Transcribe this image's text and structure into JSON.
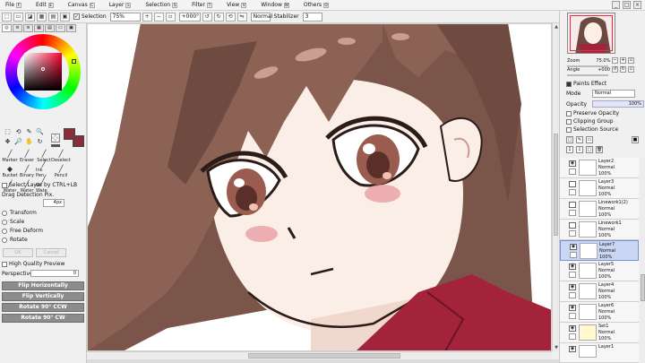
{
  "menubar": {
    "items": [
      {
        "label": "File",
        "key": "F"
      },
      {
        "label": "Edit",
        "key": "E"
      },
      {
        "label": "Canvas",
        "key": "C"
      },
      {
        "label": "Layer",
        "key": "L"
      },
      {
        "label": "Selection",
        "key": "S"
      },
      {
        "label": "Filter",
        "key": "T"
      },
      {
        "label": "View",
        "key": "V"
      },
      {
        "label": "Window",
        "key": "W"
      },
      {
        "label": "Others",
        "key": "O"
      }
    ],
    "window_controls": [
      "_",
      "□",
      "×"
    ]
  },
  "toolbar": {
    "selection_label": "Selection",
    "selection_checked": true,
    "zoom": "75%",
    "rotation": "+000°",
    "blend_mode": "Normal",
    "stabilizer_label": "Stabilizer",
    "stabilizer_value": "3"
  },
  "left_panel": {
    "primary_color": "#8a2d3b",
    "small_tools": [
      "⬚",
      "⟲",
      "✎",
      "🔍",
      "✥",
      "🔎",
      "✋",
      "↻"
    ],
    "brush_tools": [
      {
        "label": "Marker",
        "icon": "marker-icon"
      },
      {
        "label": "Eraser",
        "icon": "eraser-icon"
      },
      {
        "label": "Select",
        "icon": "select-brush-icon"
      },
      {
        "label": "Deselect",
        "icon": "deselect-icon"
      },
      {
        "label": "",
        "icon": "empty"
      },
      {
        "label": "Bucket",
        "icon": "bucket-icon"
      },
      {
        "label": "Binary",
        "icon": "binary-icon"
      },
      {
        "label": "Ink Pen",
        "icon": "ink-pen-icon"
      },
      {
        "label": "Pencil",
        "icon": "pencil-icon"
      },
      {
        "label": "",
        "icon": "empty"
      },
      {
        "label": "Water",
        "icon": "water-icon"
      },
      {
        "label": "Water",
        "icon": "water-icon"
      },
      {
        "label": "Oil Wate",
        "icon": "oil-water-icon"
      },
      {
        "label": "",
        "icon": "empty"
      },
      {
        "label": "",
        "icon": "empty"
      }
    ],
    "select_layer_ctrl_lb": "Select Layer by CTRL+LB",
    "drag_detection_label": "Drag Detection Pix.",
    "drag_detection_value": "4px",
    "transform_options": [
      "Transform",
      "Scale",
      "Free Deform",
      "Rotate"
    ],
    "ok_label": "OK",
    "cancel_label": "Cancel",
    "high_quality_preview": "High Quality Preview",
    "perspective_label": "Perspective",
    "perspective_value": "0",
    "action_buttons": [
      "Flip Horizontally",
      "Flip Vertically",
      "Rotate 90° CCW",
      "Rotate 90° CW"
    ]
  },
  "right_panel": {
    "zoom_label": "Zoom",
    "zoom_value": "75.0%",
    "angle_label": "Angle",
    "angle_value": "+000",
    "paints_effect": "Paints Effect",
    "mode_label": "Mode",
    "mode_value": "Normal",
    "opacity_label": "Opacity",
    "opacity_value": "100%",
    "preserve_opacity": "Preserve Opacity",
    "clipping_group": "Clipping Group",
    "selection_source": "Selection Source",
    "layers": [
      {
        "name": "Layer2",
        "mode": "Normal",
        "opacity": "100%",
        "selected": false
      },
      {
        "name": "Layer3",
        "mode": "Normal",
        "opacity": "100%",
        "selected": false
      },
      {
        "name": "Linework1(2)",
        "mode": "Normal",
        "opacity": "100%",
        "selected": false
      },
      {
        "name": "Linework1",
        "mode": "Normal",
        "opacity": "100%",
        "selected": false
      },
      {
        "name": "Layer7",
        "mode": "Normal",
        "opacity": "100%",
        "selected": true
      },
      {
        "name": "Layer5",
        "mode": "Normal",
        "opacity": "100%",
        "selected": false
      },
      {
        "name": "Layer4",
        "mode": "Normal",
        "opacity": "100%",
        "selected": false
      },
      {
        "name": "Layer6",
        "mode": "Normal",
        "opacity": "100%",
        "selected": false
      },
      {
        "name": "Set1",
        "mode": "Normal",
        "opacity": "100%",
        "selected": false
      },
      {
        "name": "Layer1",
        "mode": "",
        "opacity": "",
        "selected": false
      }
    ]
  },
  "canvas": {
    "hair_color": "#7b5549",
    "hair_dark": "#4a2f2c",
    "skin_color": "#fbeee6",
    "eye_color": "#9a5c4e",
    "blush_color": "#e9a2a6",
    "outline_color": "#2b1c1a",
    "scarf_color": "#a3233a"
  }
}
